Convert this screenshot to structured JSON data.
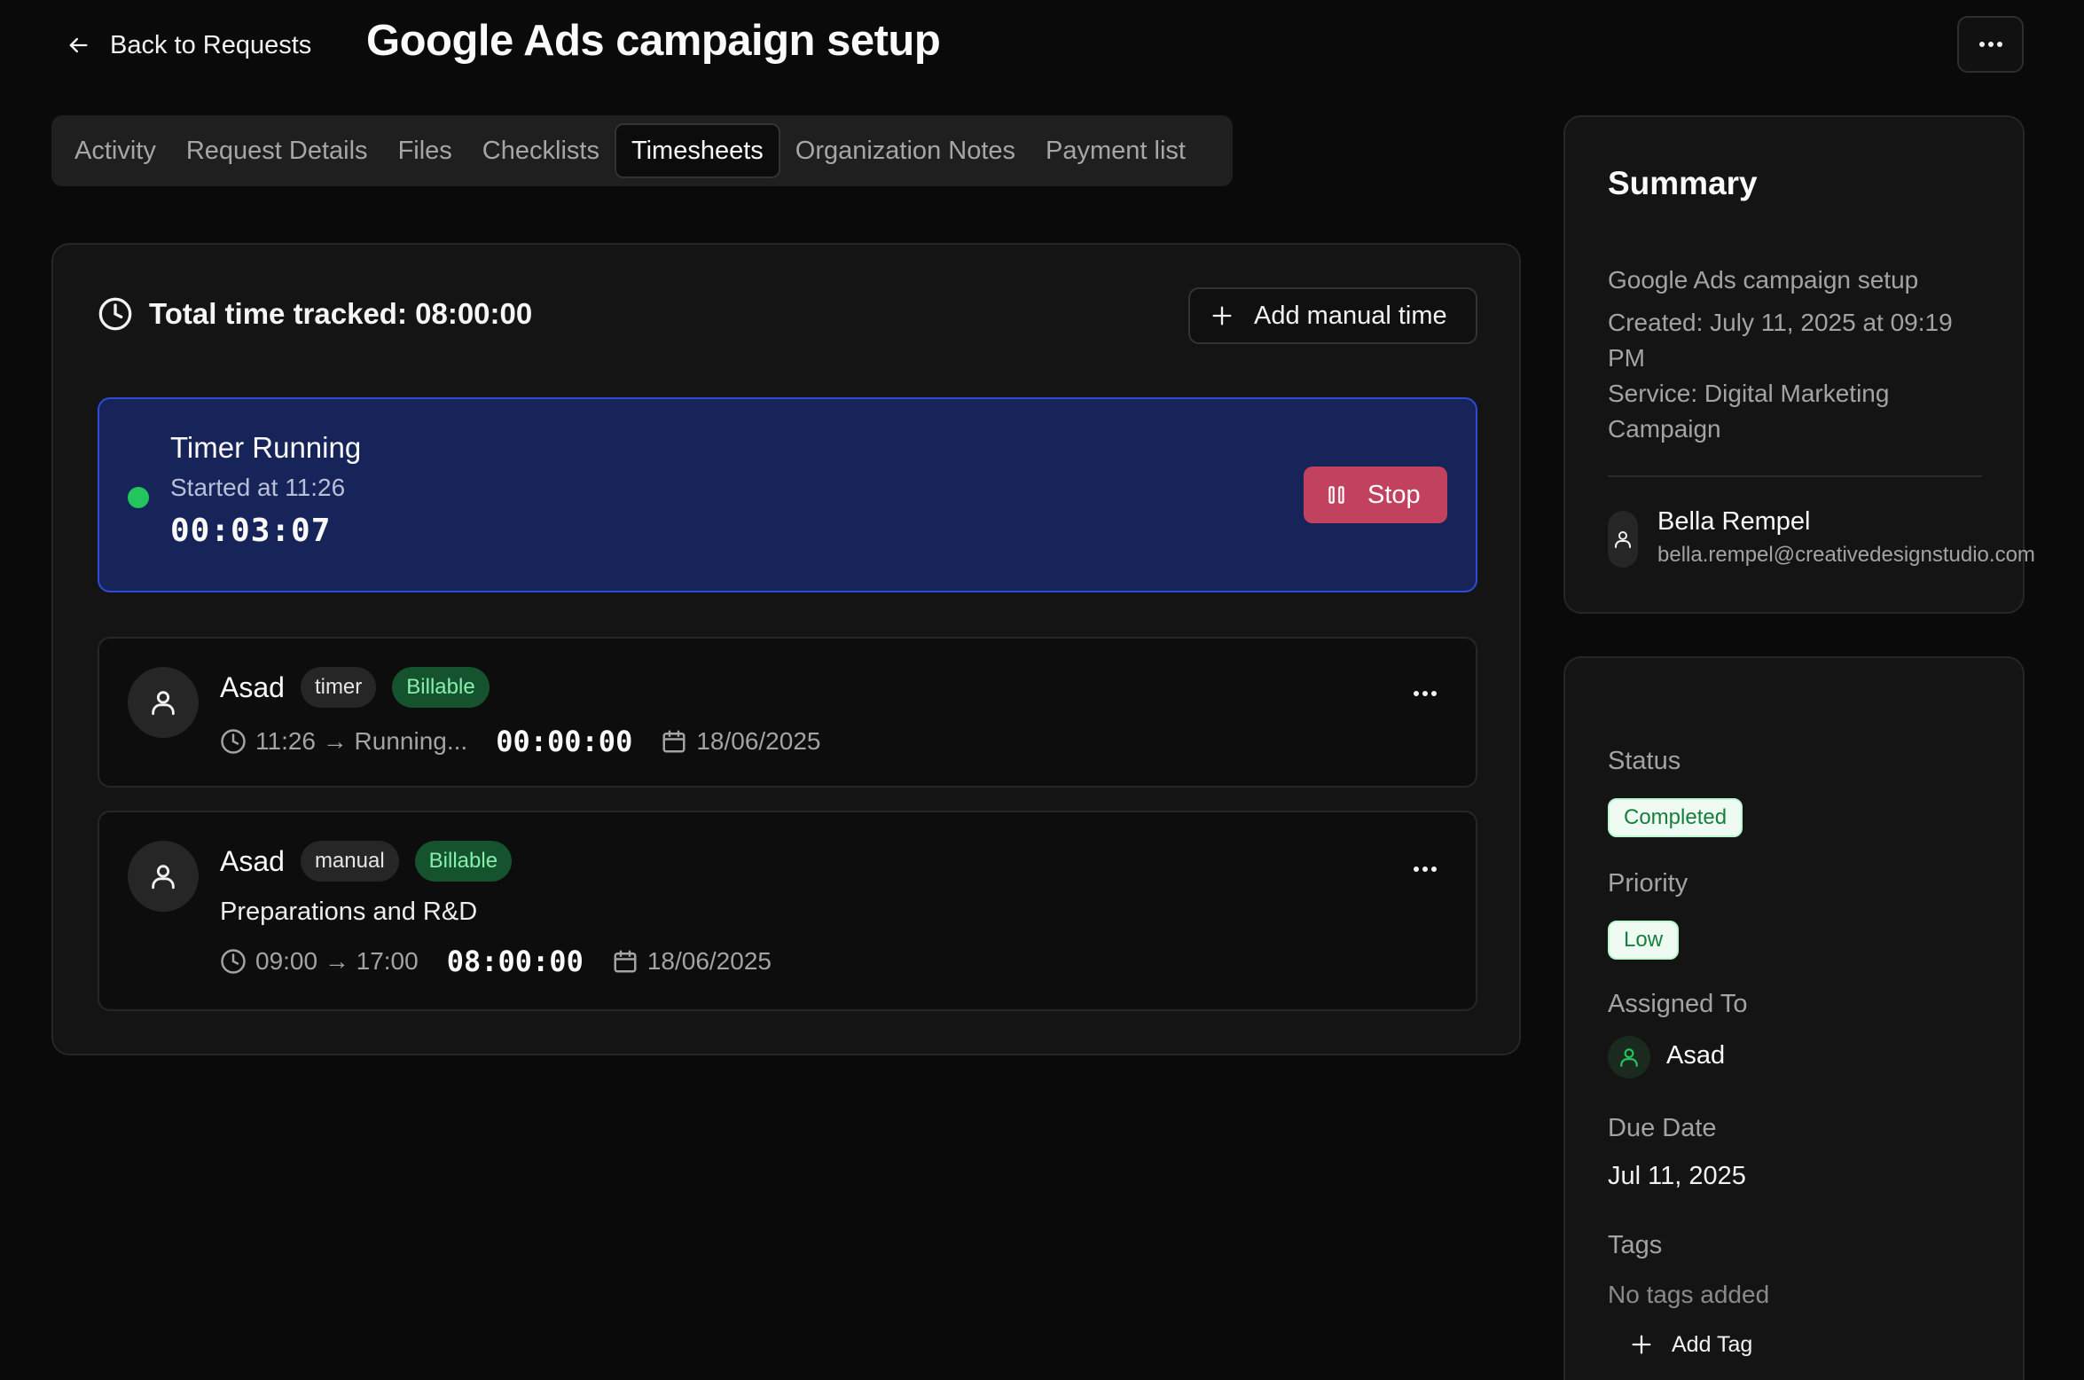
{
  "header": {
    "back_label": "Back to Requests",
    "title": "Google Ads campaign setup",
    "back_icon": "arrow-left-icon",
    "more_icon": "more-horizontal-icon"
  },
  "tabs": [
    {
      "label": "Activity",
      "active": false
    },
    {
      "label": "Request Details",
      "active": false
    },
    {
      "label": "Files",
      "active": false
    },
    {
      "label": "Checklists",
      "active": false
    },
    {
      "label": "Timesheets",
      "active": true
    },
    {
      "label": "Organization Notes",
      "active": false
    },
    {
      "label": "Payment list",
      "active": false
    }
  ],
  "timesheet": {
    "total_label": "Total time tracked: 08:00:00",
    "add_manual_label": "Add manual time",
    "timer": {
      "title": "Timer Running",
      "started": "Started at 11:26",
      "elapsed": "00:03:07",
      "stop_label": "Stop",
      "status_color": "#22c55e"
    },
    "entries": [
      {
        "user": "Asad",
        "type": "timer",
        "billing": "Billable",
        "description": "",
        "range": "11:26 → Running...",
        "duration": "00:00:00",
        "date": "18/06/2025"
      },
      {
        "user": "Asad",
        "type": "manual",
        "billing": "Billable",
        "description": "Preparations and R&D",
        "range": "09:00 → 17:00",
        "duration": "08:00:00",
        "date": "18/06/2025"
      }
    ]
  },
  "summary": {
    "title": "Summary",
    "request_name": "Google Ads campaign setup",
    "created": "Created: July 11, 2025 at 09:19 PM",
    "service": "Service: Digital Marketing Campaign",
    "client": {
      "name": "Bella Rempel",
      "email": "bella.rempel@creativedesignstudio.com"
    }
  },
  "details": {
    "status_label": "Status",
    "status_value": "Completed",
    "priority_label": "Priority",
    "priority_value": "Low",
    "assigned_label": "Assigned To",
    "assigned_value": "Asad",
    "due_label": "Due Date",
    "due_value": "Jul 11, 2025",
    "tags_label": "Tags",
    "tags_empty": "No tags added",
    "add_tag_label": "Add Tag"
  },
  "colors": {
    "accent_blue": "#2f4ad6",
    "stop_red": "#c2415e",
    "billable_green": "#14532d",
    "status_green": "#15803d"
  }
}
